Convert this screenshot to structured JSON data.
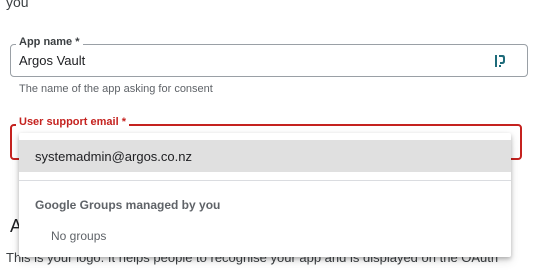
{
  "intro": {
    "text": "you"
  },
  "app_name": {
    "label": "App name *",
    "value": "Argos Vault",
    "icon": "password-manager-icon",
    "helper": "The name of the app asking for consent"
  },
  "support_email": {
    "label": "User support email *",
    "error_color": "#c5221f"
  },
  "dropdown": {
    "selected_option": "systemadmin@argos.co.nz",
    "group_heading": "Google Groups managed by you",
    "empty_text": "No groups"
  },
  "background": {
    "section_letter": "A",
    "logo_text": "This is your logo. It helps people to recognise your app and is displayed on the OAuth"
  }
}
